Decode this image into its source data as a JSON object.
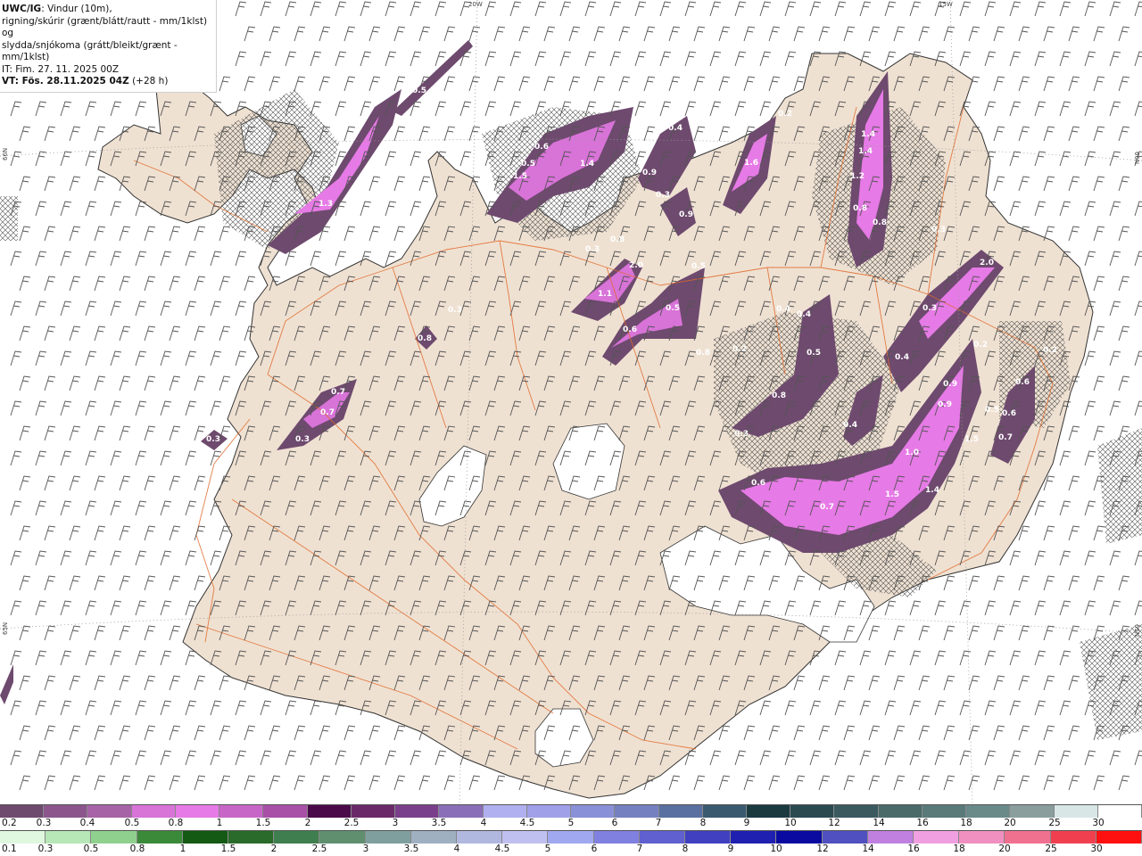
{
  "title": {
    "source": "UWC/IG",
    "line1": ": Vindur (10m),",
    "line2": "rigning/skúrir (grænt/blátt/rautt - mm/1klst) og",
    "line3": "slydda/snjókoma (grátt/bleikt/grænt - mm/1klst)",
    "it": "IT: Fim. 27. 11. 2025 00Z",
    "vt": "VT: Fös. 28.11.2025 04Z",
    "lead": " (+28 h)"
  },
  "graticule_labels": [
    "20W",
    "15W",
    "66N",
    "66N",
    "65N",
    "65N"
  ],
  "precip_labels": [
    "0.5",
    "1.3",
    "0.6",
    "1.5",
    "1.4",
    "0.5",
    "0.4",
    "0.9",
    "0.3",
    "0.9",
    "1.6",
    "0.2",
    "1.4",
    "1.4",
    "1.2",
    "0.8",
    "0.8",
    "0.3",
    "0.8",
    "0.3",
    "2.0",
    "1.1",
    "0.5",
    "0.5",
    "0.6",
    "0.8",
    "0.3",
    "2.0",
    "0.3",
    "0.4",
    "0.4",
    "0.5",
    "0.2",
    "0.4",
    "0.2",
    "0.2",
    "0.8",
    "0.9",
    "0.9",
    "0.4",
    "0.5",
    "0.6",
    "0.6",
    "0.3",
    "0.3",
    "0.7",
    "0.7",
    "0.3",
    "0.6",
    "1.5",
    "1.0",
    "1.5",
    "1.4",
    "0.7",
    "0.8",
    "0.7"
  ],
  "legend_snow": {
    "labels": [
      "0.2",
      "0.3",
      "0.4",
      "0.5",
      "0.8",
      "1",
      "1.5",
      "2",
      "2.5",
      "3",
      "3.5",
      "4",
      "4.5",
      "5",
      "6",
      "7",
      "8",
      "9",
      "10",
      "12",
      "14",
      "16",
      "18",
      "20",
      "25",
      "30"
    ],
    "colors": [
      "#6e4a6e",
      "#8c568c",
      "#a663a6",
      "#d873d8",
      "#e67ae6",
      "#c866c8",
      "#a84fa8",
      "#4a0a4a",
      "#6a2a6a",
      "#7a3f8a",
      "#8a6fb8",
      "#b0b0f0",
      "#a0a0e8",
      "#8a90d8",
      "#7580c0",
      "#5a70a0",
      "#3a5a70",
      "#1a3a40",
      "#2a4a50",
      "#3a5a60",
      "#4a6a6a",
      "#5a7a7a",
      "#6a8a8a",
      "#8a9e9e",
      "#d8e6e6",
      "#ffffff"
    ]
  },
  "legend_rain": {
    "labels": [
      "0.1",
      "0.3",
      "0.5",
      "0.8",
      "1",
      "1.5",
      "2",
      "2.5",
      "3",
      "3.5",
      "4",
      "4.5",
      "5",
      "6",
      "7",
      "8",
      "9",
      "10",
      "12",
      "14",
      "16",
      "18",
      "20",
      "25",
      "30"
    ],
    "colors": [
      "#dff7df",
      "#b7e6b7",
      "#8fd08f",
      "#3a8a3a",
      "#145a14",
      "#2a6a2a",
      "#3f7f4f",
      "#5f8f6f",
      "#7f9f9f",
      "#9fb0c0",
      "#b0b8e0",
      "#c0c0f0",
      "#a0a8f0",
      "#8080e0",
      "#6060d0",
      "#4040c0",
      "#2020b0",
      "#0a0aa0",
      "#5050c0",
      "#c080e0",
      "#f0a0e0",
      "#f090c0",
      "#f07090",
      "#f04050",
      "#ff1010"
    ]
  }
}
